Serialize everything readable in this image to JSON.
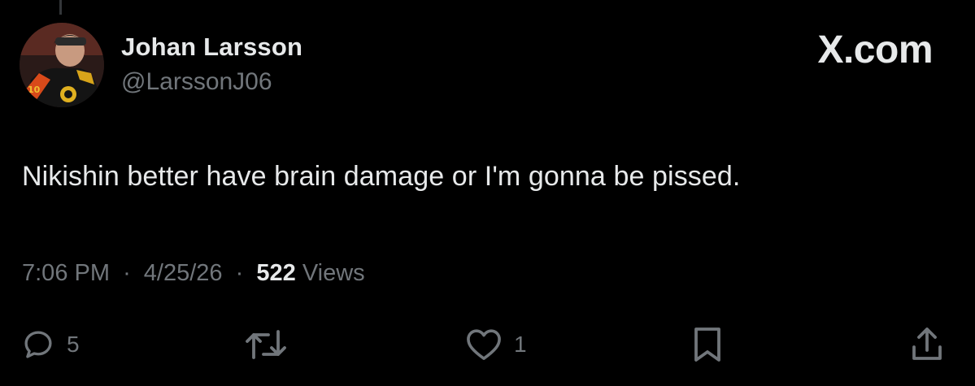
{
  "author": {
    "display_name": "Johan Larsson",
    "handle": "@LarssonJ06"
  },
  "brand": "X.com",
  "tweet": {
    "text": "Nikishin better have brain damage or I'm gonna be pissed."
  },
  "meta": {
    "time": "7:06 PM",
    "separator": "·",
    "date": "4/25/26",
    "views_count": "522",
    "views_label": "Views"
  },
  "actions": {
    "reply_count": "5",
    "like_count": "1"
  },
  "colors": {
    "background": "#000000",
    "primary_text": "#e7e9ea",
    "secondary_text": "#71767b"
  },
  "icons": [
    "reply-icon",
    "retweet-icon",
    "like-icon",
    "bookmark-icon",
    "share-icon"
  ]
}
